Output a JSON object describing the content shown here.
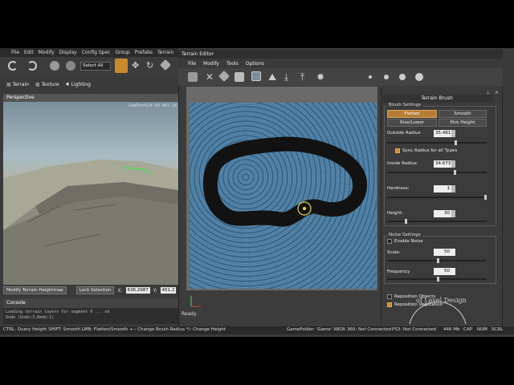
{
  "main_menu": [
    "File",
    "Edit",
    "Modify",
    "Display",
    "Config Spec",
    "Group",
    "Prefabs",
    "Terrain"
  ],
  "toolbar": {
    "select_all": "Select All"
  },
  "mode_bar": {
    "terrain": "Terrain",
    "texture": "Texture",
    "lighting": "Lighting"
  },
  "viewport": {
    "title": "Perspective",
    "campos": "CamPos=114.60 661.18"
  },
  "viewport_status": {
    "mode_label": "Modify Terrain Heightmap",
    "lock_button": "Lock Selection",
    "x_label": "X:",
    "x_value": "636.2987",
    "y_label": "Y:",
    "y_value": "451.2"
  },
  "console": {
    "title": "Console",
    "lines": [
      "Loading terrain layers for segment 0 ... ok",
      "Undo (Undo:3,Redo:1)"
    ]
  },
  "status_bar": {
    "hints": "CTRL: Query Height  SHIFT: Smooth  LMB: Flatten/Smooth  +-: Change Brush Radius  */: Change Height",
    "gamefolder": "GameFolder: 'Game'",
    "xbox": "XBOX 360: Not Connected",
    "ps3": "PS3: Not Connected",
    "memory": "446 Mb",
    "cap": "CAP",
    "num": "NUM",
    "scrl": "SCRL"
  },
  "terrain_editor": {
    "title": "Terrain Editor",
    "menu": [
      "File",
      "Modify",
      "Tools",
      "Options"
    ],
    "status": "Ready"
  },
  "panel": {
    "title": "Terrain Brush",
    "brush_settings": {
      "label": "Brush Settings",
      "flatten": "Flatten",
      "smooth": "Smooth",
      "rise_lower": "Rise/Lower",
      "pick_height": "Pick Height",
      "outside_radius_label": "Outside Radius",
      "outside_radius": "35.481",
      "sync_radius_label": "Sync Radius for all Types",
      "sync_radius": true,
      "inside_radius_label": "Inside Radius:",
      "inside_radius": "34.673",
      "hardness_label": "Hardness:",
      "hardness": "1",
      "height_label": "Height:",
      "height": "30"
    },
    "noise_settings": {
      "label": "Noise Settings",
      "enable_label": "Enable Noise",
      "enable": false,
      "scale_label": "Scale:",
      "scale": "50",
      "frequency_label": "Frequency",
      "frequency": "50"
    },
    "reposition_objects_label": "Reposition Objects",
    "reposition_objects": false,
    "reposition_vegetation_label": "Reposition Vegetation",
    "reposition_vegetation": true
  },
  "watermark": "of Level Design"
}
